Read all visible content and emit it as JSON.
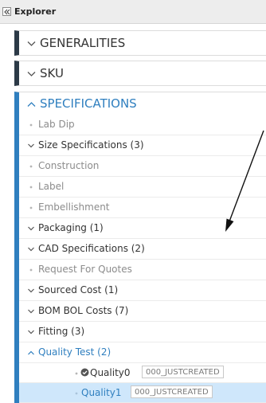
{
  "explorer": {
    "title": "Explorer",
    "collapse_icon": "double-chevron-left-icon"
  },
  "sections": {
    "generalities": {
      "label": "GENERALITIES",
      "expanded": false
    },
    "sku": {
      "label": "SKU",
      "expanded": false
    },
    "specifications": {
      "label": "SPECIFICATIONS",
      "expanded": true
    }
  },
  "tree": [
    {
      "label": "Lab Dip",
      "kind": "leaf"
    },
    {
      "label": "Size Specifications (3)",
      "kind": "collapsed"
    },
    {
      "label": "Construction",
      "kind": "leaf"
    },
    {
      "label": "Label",
      "kind": "leaf"
    },
    {
      "label": "Embellishment",
      "kind": "leaf"
    },
    {
      "label": "Packaging (1)",
      "kind": "collapsed"
    },
    {
      "label": "CAD Specifications (2)",
      "kind": "collapsed"
    },
    {
      "label": "Request For Quotes",
      "kind": "leaf"
    },
    {
      "label": "Sourced Cost (1)",
      "kind": "collapsed"
    },
    {
      "label": "BOM BOL Costs (7)",
      "kind": "collapsed"
    },
    {
      "label": "Fitting (3)",
      "kind": "collapsed"
    },
    {
      "label": "Quality Test (2)",
      "kind": "expanded"
    }
  ],
  "quality_items": [
    {
      "label": "Quality0",
      "status": "000_JUSTCREATED",
      "checked": true,
      "selected": false
    },
    {
      "label": "Quality1",
      "status": "000_JUSTCREATED",
      "checked": false,
      "selected": true
    }
  ],
  "colors": {
    "accent": "#2f7fbf",
    "dark_bar": "#2c3a47",
    "selected_bg": "#cfe7fb"
  }
}
